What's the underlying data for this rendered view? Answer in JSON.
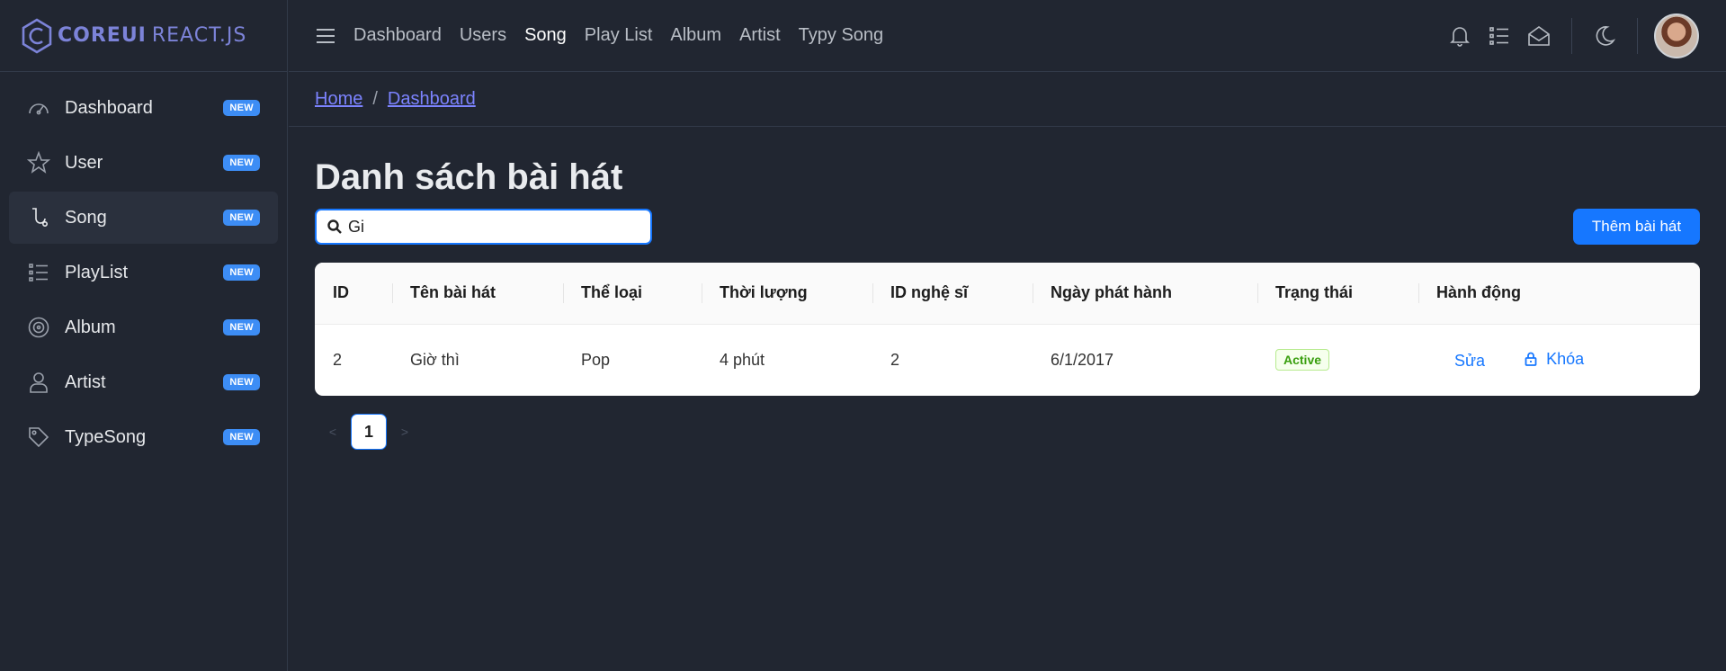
{
  "brand": {
    "part1": "COREUI",
    "part2": "REACT.JS"
  },
  "sidebar": {
    "items": [
      {
        "label": "Dashboard",
        "badge": "NEW",
        "icon": "speedometer-icon"
      },
      {
        "label": "User",
        "badge": "NEW",
        "icon": "star-icon"
      },
      {
        "label": "Song",
        "badge": "NEW",
        "icon": "cursor-icon"
      },
      {
        "label": "PlayList",
        "badge": "NEW",
        "icon": "list-icon"
      },
      {
        "label": "Album",
        "badge": "NEW",
        "icon": "disc-icon"
      },
      {
        "label": "Artist",
        "badge": "NEW",
        "icon": "user-icon"
      },
      {
        "label": "TypeSong",
        "badge": "NEW",
        "icon": "tag-icon"
      }
    ],
    "active": "Song"
  },
  "header": {
    "nav": [
      "Dashboard",
      "Users",
      "Song",
      "Play List",
      "Album",
      "Artist",
      "Typy Song"
    ],
    "active": "Song",
    "icons": [
      "bell-icon",
      "list-icon",
      "envelope-icon",
      "moon-icon"
    ]
  },
  "breadcrumb": {
    "items": [
      "Home",
      "Dashboard"
    ],
    "separator": "/"
  },
  "main": {
    "title": "Danh sách bài hát",
    "search_value": "Gi",
    "add_button": "Thêm bài hát"
  },
  "table": {
    "columns": [
      "ID",
      "Tên bài hát",
      "Thể loại",
      "Thời lượng",
      "ID nghệ sĩ",
      "Ngày phát hành",
      "Trạng thái",
      "Hành động"
    ],
    "rows": [
      {
        "id": "2",
        "name": "Giờ thì",
        "genre": "Pop",
        "duration": "4 phút",
        "artist_id": "2",
        "release_date": "6/1/2017",
        "status": "Active",
        "edit": "Sửa",
        "lock": "Khóa"
      }
    ]
  },
  "pagination": {
    "current": "1",
    "prev": "<",
    "next": ">"
  },
  "colors": {
    "bg": "#212631",
    "accent": "#1677ff",
    "badge": "#3d8df5",
    "link": "#7c83ff"
  }
}
